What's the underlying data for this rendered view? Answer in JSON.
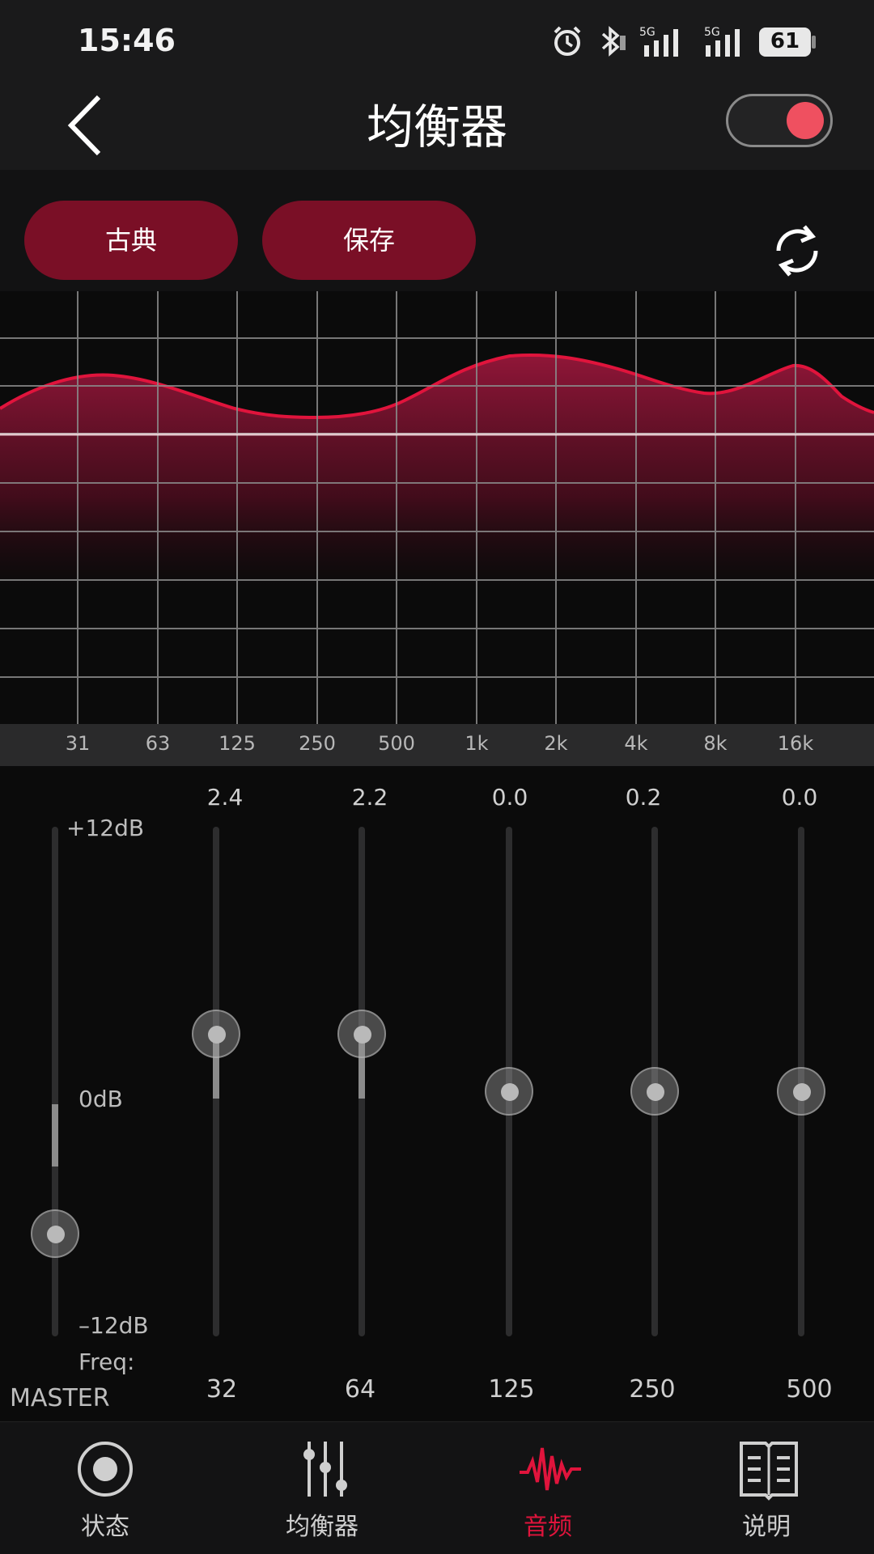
{
  "status_bar": {
    "time": "15:46",
    "battery": "61"
  },
  "header": {
    "title": "均衡器",
    "toggle_on": true
  },
  "presets": {
    "preset_label": "古典",
    "save_label": "保存"
  },
  "graph": {
    "freq_labels": [
      "31",
      "63",
      "125",
      "250",
      "500",
      "1k",
      "2k",
      "4k",
      "8k",
      "16k"
    ]
  },
  "bands": {
    "master_label": "MASTER",
    "db_max": "+12dB",
    "db_zero": "0dB",
    "db_min": "–12dB",
    "freq_label": "Freq:",
    "items": [
      {
        "value": "2.4",
        "freq": "32"
      },
      {
        "value": "2.2",
        "freq": "64"
      },
      {
        "value": "0.0",
        "freq": "125"
      },
      {
        "value": "0.2",
        "freq": "250"
      },
      {
        "value": "0.0",
        "freq": "500"
      }
    ]
  },
  "nav": {
    "items": [
      {
        "label": "状态",
        "icon": "radio-dot-icon",
        "active": false
      },
      {
        "label": "均衡器",
        "icon": "sliders-icon",
        "active": false
      },
      {
        "label": "音频",
        "icon": "waveform-icon",
        "active": true
      },
      {
        "label": "说明",
        "icon": "book-icon",
        "active": false
      }
    ]
  },
  "colors": {
    "accent": "#e0143c",
    "pill": "#7a0f26",
    "toggle_knob": "#ef5060"
  }
}
